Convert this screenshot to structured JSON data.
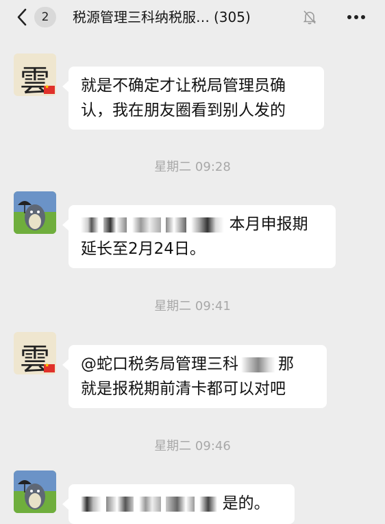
{
  "header": {
    "unread_count": "2",
    "title": "税源管理三科纳税服…",
    "member_count": "(305)"
  },
  "messages": [
    {
      "sender": "yun",
      "lines": [
        "就是不确定才让税局管理员确",
        "认，我在朋友圈看到别人发的"
      ]
    },
    {
      "time": "星期二 09:28"
    },
    {
      "sender": "totoro",
      "lines": [
        "本月申报期",
        "延长至2月24日。"
      ]
    },
    {
      "time": "星期二 09:41"
    },
    {
      "sender": "yun",
      "lines": [
        "@蛇口税务局管理三科",
        "那",
        "就是报税期前清卡都可以对吧"
      ]
    },
    {
      "time": "星期二 09:46"
    },
    {
      "sender": "totoro",
      "lines": [
        "是的。"
      ]
    }
  ],
  "avatars": {
    "yun_char": "雲"
  },
  "colors": {
    "background": "#ededed",
    "bubble": "#ffffff",
    "timestamp": "#a8a8a8"
  }
}
